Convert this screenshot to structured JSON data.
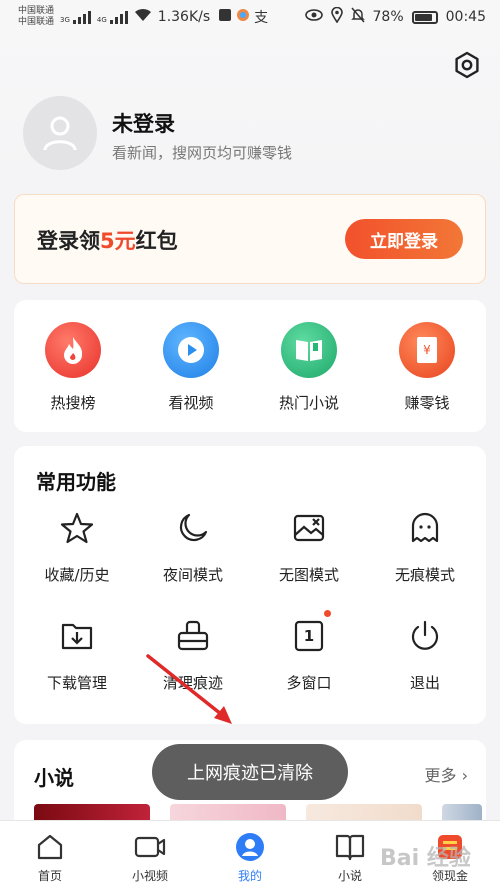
{
  "status_bar": {
    "carrier1": "中国联通",
    "carrier1_net": "3G",
    "carrier2": "中国联通",
    "carrier2_net": "4G",
    "speed": "1.36K/s",
    "extra_icons": "支",
    "battery": "78%",
    "battery_level": 0.78,
    "time": "00:45"
  },
  "header": {
    "title": "未登录",
    "subtitle": "看新闻，搜网页均可赚零钱"
  },
  "login_banner": {
    "text_prefix": "登录领",
    "amount": "5元",
    "text_suffix": "红包",
    "button": "立即登录"
  },
  "quick_actions": [
    {
      "label": "热搜榜",
      "icon": "flame-icon",
      "color": "#f0443a"
    },
    {
      "label": "看视频",
      "icon": "play-icon",
      "color": "#2b8ff0"
    },
    {
      "label": "热门小说",
      "icon": "book-icon",
      "color": "#27b877"
    },
    {
      "label": "赚零钱",
      "icon": "money-icon",
      "color": "#f2512c"
    }
  ],
  "functions": {
    "title": "常用功能",
    "items": [
      {
        "label": "收藏/历史",
        "icon": "star-icon"
      },
      {
        "label": "夜间模式",
        "icon": "moon-icon"
      },
      {
        "label": "无图模式",
        "icon": "no-image-icon"
      },
      {
        "label": "无痕模式",
        "icon": "ghost-icon"
      },
      {
        "label": "下载管理",
        "icon": "download-icon"
      },
      {
        "label": "清理痕迹",
        "icon": "broom-icon"
      },
      {
        "label": "多窗口",
        "icon": "window-icon",
        "badge_text": "1"
      },
      {
        "label": "退出",
        "icon": "power-icon"
      }
    ]
  },
  "novel": {
    "title": "小说",
    "more": "更多 ›"
  },
  "toast": "上网痕迹已清除",
  "tabbar": [
    {
      "label": "首页",
      "icon": "home-icon"
    },
    {
      "label": "小视频",
      "icon": "video-icon"
    },
    {
      "label": "我的",
      "icon": "profile-icon"
    },
    {
      "label": "小说",
      "icon": "book-icon"
    },
    {
      "label": "领现金",
      "icon": "cash-icon"
    }
  ],
  "watermark": "Bai 经验",
  "colors": {
    "accent": "#f04a2c",
    "tab_active": "#2f7df6"
  }
}
